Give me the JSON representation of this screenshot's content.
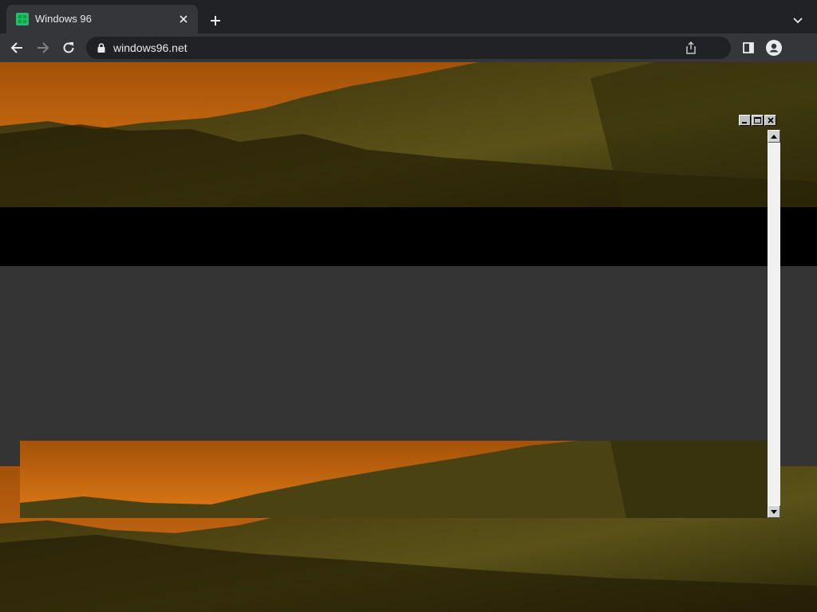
{
  "tab": {
    "title": "Windows 96",
    "favicon": "windows96-logo-icon"
  },
  "toolbar": {
    "url": "windows96.net"
  },
  "icons": {
    "back": "back-arrow-icon",
    "forward": "forward-arrow-icon",
    "reload": "reload-icon",
    "lock": "lock-icon",
    "share": "share-icon",
    "side_panel": "side-panel-icon",
    "profile": "profile-icon",
    "new_tab": "plus-icon",
    "tab_close": "close-icon",
    "tab_search": "chevron-down-icon"
  },
  "window": {
    "controls": [
      "minimize",
      "maximize",
      "close"
    ]
  },
  "colors": {
    "chrome_dark": "#202124",
    "chrome_toolbar": "#35363a",
    "page_grey": "#333333",
    "sky_orange": "#c8690e",
    "hills_olive": "#4a4212"
  }
}
